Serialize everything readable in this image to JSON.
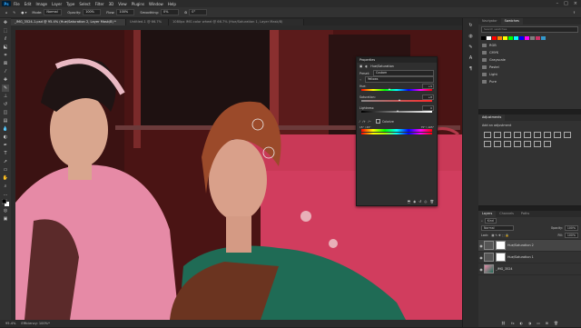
{
  "menubar": {
    "logo": "Ps",
    "items": [
      "File",
      "Edit",
      "Image",
      "Layer",
      "Type",
      "Select",
      "Filter",
      "3D",
      "View",
      "Plugins",
      "Window",
      "Help"
    ],
    "controls": [
      "–",
      "□",
      "×"
    ]
  },
  "options": {
    "mode_label": "Mode:",
    "mode_value": "Normal",
    "opacity_label": "Opacity:",
    "opacity_value": "100%",
    "flow_label": "Flow:",
    "flow_value": "100%",
    "smoothing_label": "Smoothing:",
    "smoothing_value": "0%",
    "angle_value": "0°"
  },
  "tabs": [
    {
      "label": "_IMG_3524-1.psd @ 95.4% (Hue/Saturation 2, Layer Mask/8) *",
      "active": true
    },
    {
      "label": "Untitled-1 @ 66.7%",
      "active": false
    },
    {
      "label": "1080px IMG color wheel @ 66.7% (Hue/Saturation 1, Layer Mask/8)",
      "active": false
    }
  ],
  "status": {
    "zoom": "95.4%",
    "info": "Efficiency: 100%*"
  },
  "swatches_panel": {
    "tabs": [
      "Navigator",
      "Swatches"
    ],
    "search_placeholder": "Search swatches",
    "colors": [
      "#000000",
      "#ffffff",
      "#ff0000",
      "#ff7f00",
      "#ffff00",
      "#00ff00",
      "#00ffff",
      "#0000ff",
      "#ff00ff",
      "#7f7f7f",
      "#cc3366",
      "#3399cc"
    ],
    "groups": [
      "RGB",
      "CMYK",
      "Grayscale",
      "Pastel",
      "Light",
      "Pure"
    ]
  },
  "adjustments_panel": {
    "title": "Adjustments",
    "subtitle": "Add an adjustment"
  },
  "layers_panel": {
    "tabs": [
      "Layers",
      "Channels",
      "Paths"
    ],
    "kind_label": "Kind",
    "blend_mode": "Normal",
    "opacity_label": "Opacity:",
    "opacity_value": "100%",
    "lock_label": "Lock:",
    "fill_label": "Fill:",
    "fill_value": "100%",
    "layers": [
      {
        "name": "Hue/Saturation 2",
        "active": true
      },
      {
        "name": "Hue/Saturation 1",
        "active": false
      },
      {
        "name": "_IMG_3524",
        "active": false
      }
    ]
  },
  "properties_panel": {
    "title": "Properties",
    "adjustment_name": "Hue/Saturation",
    "preset_label": "Preset:",
    "preset_value": "Custom",
    "channel_value": "Yellows",
    "hue_label": "Hue:",
    "hue_value": "+9",
    "saturation_label": "Saturation:",
    "saturation_value": "+8",
    "lightness_label": "Lightness:",
    "lightness_value": "0",
    "colorize_label": "Colorize",
    "range_left": "15° / 45°",
    "range_right": "75° \\ 105°"
  },
  "colors": {
    "accent": "#31a8ff",
    "panel_bg": "#323232",
    "canvas_wall": "#d13d5e"
  }
}
